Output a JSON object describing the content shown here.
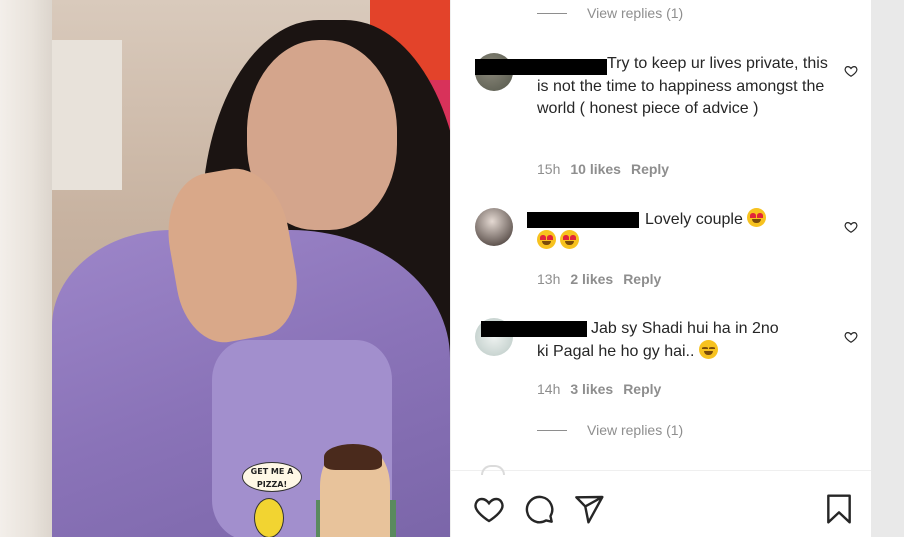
{
  "media": {
    "comic_bubble": "GET ME A PIZZA!"
  },
  "comments_panel": {
    "view_replies_top": "View replies (1)",
    "comments": [
      {
        "text": "Try to keep ur lives private, this is not the time to happiness amongst the world ( honest piece of advice )",
        "time": "15h",
        "likes": "10 likes",
        "reply": "Reply"
      },
      {
        "text": "Lovely couple",
        "time": "13h",
        "likes": "2 likes",
        "reply": "Reply"
      },
      {
        "text_line1": "Jab sy Shadi hui ha in 2no",
        "text_line2": "ki Pagal he ho gy hai..",
        "time": "14h",
        "likes": "3 likes",
        "reply": "Reply"
      }
    ],
    "view_replies_bottom": "View replies (1)"
  },
  "icons": {
    "like": "heart-icon",
    "comment": "comment-icon",
    "share": "share-icon",
    "save": "bookmark-icon"
  },
  "colors": {
    "text": "#262626",
    "muted": "#8e8e8e",
    "border": "#efefef"
  }
}
